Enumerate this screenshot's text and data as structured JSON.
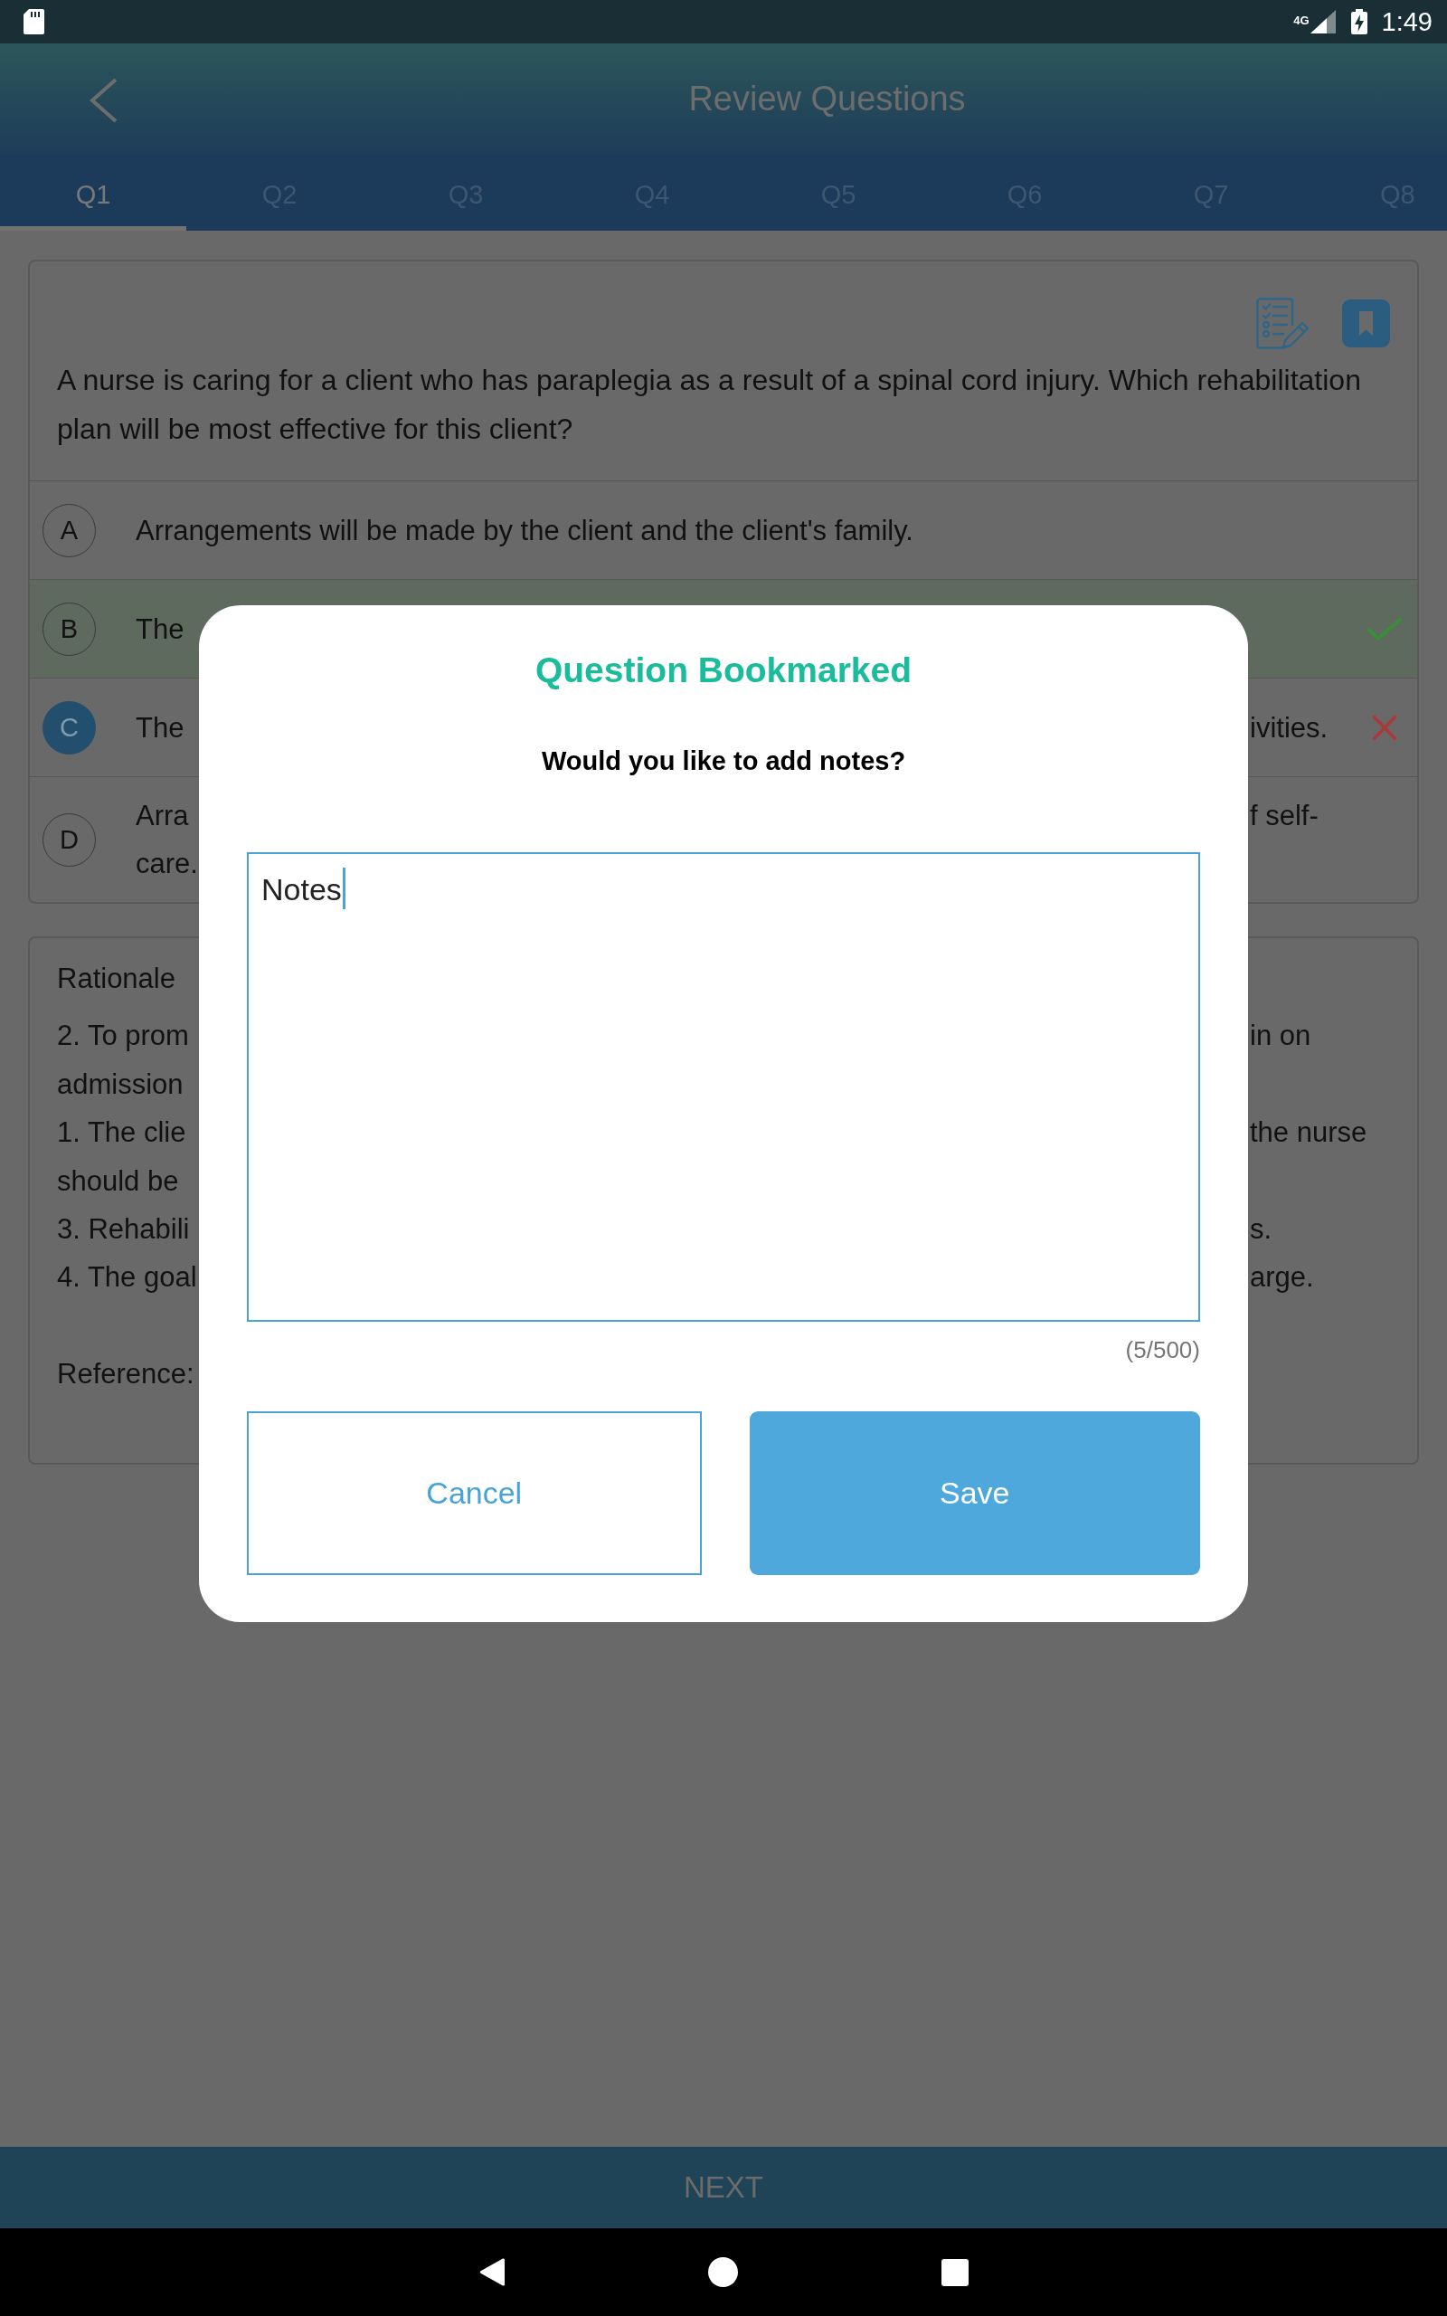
{
  "status_bar": {
    "network": "4G",
    "time": "1:49"
  },
  "header": {
    "title": "Review Questions"
  },
  "tabs": [
    {
      "label": "Q1",
      "selected": true
    },
    {
      "label": "Q2",
      "selected": false
    },
    {
      "label": "Q3",
      "selected": false
    },
    {
      "label": "Q4",
      "selected": false
    },
    {
      "label": "Q5",
      "selected": false
    },
    {
      "label": "Q6",
      "selected": false
    },
    {
      "label": "Q7",
      "selected": false
    },
    {
      "label": "Q8",
      "selected": false
    }
  ],
  "question": {
    "bookmarked": true,
    "text": "A nurse is caring for a client who has paraplegia as a result of a spinal cord injury. Which rehabilitation plan will be most effective for this client?",
    "options": [
      {
        "letter": "A",
        "selected": false,
        "correct": false,
        "lines": [
          {
            "left": "Arrangements will be made by the client and the client's family."
          }
        ]
      },
      {
        "letter": "B",
        "selected": false,
        "correct": true,
        "lines": [
          {
            "left": "The"
          }
        ]
      },
      {
        "letter": "C",
        "selected": true,
        "correct": false,
        "lines": [
          {
            "left": "The",
            "right": "ivities."
          }
        ]
      },
      {
        "letter": "D",
        "selected": false,
        "correct": false,
        "lines": [
          {
            "left": "Arra",
            "right": "f self-"
          },
          {
            "left": "care."
          }
        ]
      }
    ]
  },
  "rationale": {
    "title": "Rationale",
    "lines": [
      {
        "left": "2. To prom",
        "right": "in on"
      },
      {
        "left": "admission"
      },
      {
        "left": "1. The clie",
        "right": "the nurse"
      },
      {
        "left": "should be"
      },
      {
        "left": "3. Rehabili",
        "right": "s."
      },
      {
        "left": "4. The goal",
        "right": "arge."
      }
    ],
    "reference": "Reference:"
  },
  "dialog": {
    "title": "Question Bookmarked",
    "prompt": "Would you like to add notes?",
    "notes": {
      "value": "Notes",
      "focused": true
    },
    "counter": "(5/500)",
    "buttons": [
      {
        "label": "Cancel",
        "kind": "outline"
      },
      {
        "label": "Save",
        "kind": "filled"
      }
    ]
  },
  "footer": {
    "button": "NEXT"
  }
}
